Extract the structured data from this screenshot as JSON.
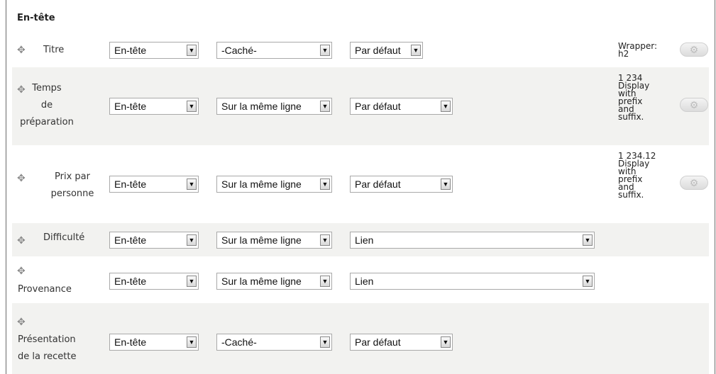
{
  "section": {
    "title": "En-tête"
  },
  "handle_icon": "✥",
  "gear_icon": "⚙",
  "rows": [
    {
      "label": "Titre",
      "region": "En-tête",
      "label_display": "-Caché-",
      "formatter": "Par défaut",
      "summary": "Wrapper:\nh2",
      "has_settings": true
    },
    {
      "label": "Temps\nde\npréparation",
      "region": "En-tête",
      "label_display": "Sur la même ligne",
      "formatter": "Par défaut",
      "summary": "1 234\nDisplay\nwith\nprefix\nand\nsuffix.",
      "has_settings": true
    },
    {
      "label": "Prix par\npersonne",
      "region": "En-tête",
      "label_display": "Sur la même ligne",
      "formatter": "Par défaut",
      "summary": "1 234.12\nDisplay\nwith\nprefix\nand\nsuffix.",
      "has_settings": true
    },
    {
      "label": "Difficulté",
      "region": "En-tête",
      "label_display": "Sur la même ligne",
      "formatter": "Lien",
      "summary": "",
      "has_settings": false
    },
    {
      "label": "Provenance",
      "region": "En-tête",
      "label_display": "Sur la même ligne",
      "formatter": "Lien",
      "summary": "",
      "has_settings": false
    },
    {
      "label": "Présentation\nde la recette",
      "region": "En-tête",
      "label_display": "-Caché-",
      "formatter": "Par défaut",
      "summary": "",
      "has_settings": false
    }
  ]
}
